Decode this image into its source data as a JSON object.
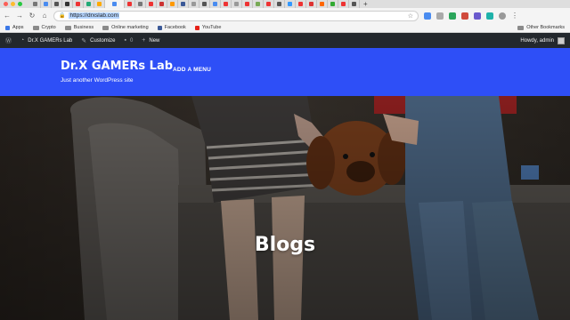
{
  "browser": {
    "tab_count_visible": 30,
    "url": "https://drxslab.com",
    "url_plain": "https://drxslab.com",
    "bookmarks": [
      {
        "label": "Apps",
        "icon": "apps-grid-icon"
      },
      {
        "label": "Crypto",
        "icon": "folder-icon"
      },
      {
        "label": "Business",
        "icon": "folder-icon"
      },
      {
        "label": "Online marketing",
        "icon": "folder-icon"
      },
      {
        "label": "Facebook",
        "icon": "facebook-icon"
      },
      {
        "label": "YouTube",
        "icon": "youtube-icon"
      }
    ],
    "other_bookmarks": "Other Bookmarks"
  },
  "adminbar": {
    "site_name": "Dr.X GAMERs Lab",
    "customize": "Customize",
    "comments": "0",
    "new": "New",
    "howdy": "Howdy, admin"
  },
  "site": {
    "title": "Dr.X GAMERs Lab",
    "menu": "ADD A MENU",
    "tagline": "Just another WordPress site",
    "accent_color": "#2e4ff7"
  },
  "hero": {
    "title": "Blogs"
  }
}
